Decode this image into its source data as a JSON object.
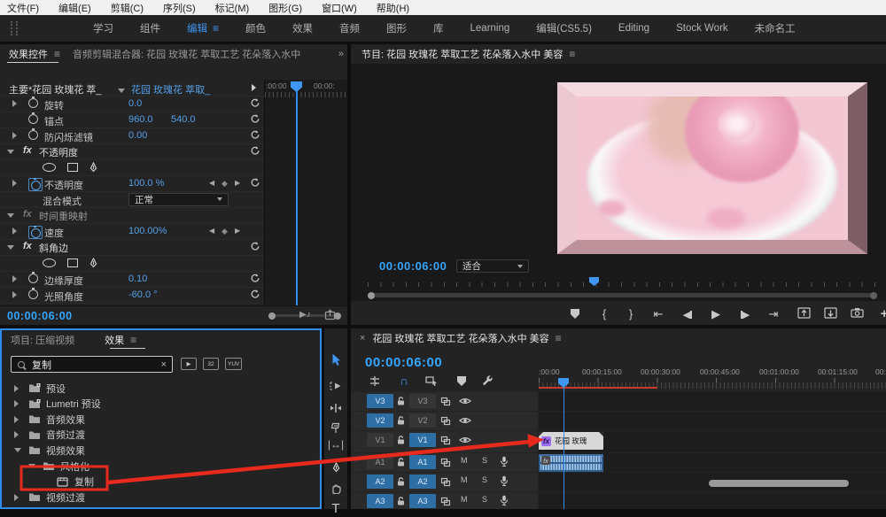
{
  "app": {
    "menu": [
      "文件(F)",
      "编辑(E)",
      "剪辑(C)",
      "序列(S)",
      "标记(M)",
      "图形(G)",
      "窗口(W)",
      "帮助(H)"
    ],
    "workspaces": [
      "学习",
      "组件",
      "编辑",
      "颜色",
      "效果",
      "音频",
      "图形",
      "库",
      "Learning",
      "编辑(CS5.5)",
      "Editing",
      "Stock Work",
      "未命名工"
    ],
    "active_workspace": "编辑"
  },
  "effect_controls": {
    "tab": "效果控件",
    "neighbor_tab": "音频剪辑混合器: 花园 玫瑰花 萃取工艺 花朵落入水中",
    "overflow_chevron": "»",
    "master_clip": "主要*花园 玫瑰花 萃_",
    "selected_clip": "花园 玫瑰花 萃取_",
    "ruler_labels": [
      ":00:00",
      "00:00:"
    ],
    "rows": [
      {
        "kind": "prop",
        "twirl": "right",
        "label": "旋转",
        "values": [
          "0.0"
        ],
        "reset": true
      },
      {
        "kind": "prop",
        "twirl": "none",
        "label": "锚点",
        "values": [
          "960.0",
          "540.0"
        ],
        "reset": true
      },
      {
        "kind": "prop",
        "twirl": "right",
        "label": "防闪烁滤镜",
        "values": [
          "0.00"
        ],
        "reset": true
      },
      {
        "kind": "fx",
        "label": "不透明度",
        "reset": true,
        "dim": false
      },
      {
        "kind": "shapes"
      },
      {
        "kind": "prop",
        "twirl": "right",
        "label": "不透明度",
        "values": [
          "100.0 %"
        ],
        "keyframe_nav": true,
        "reset": true,
        "stopwatch_on": true
      },
      {
        "kind": "select",
        "label": "混合模式",
        "value": "正常",
        "reset": true
      },
      {
        "kind": "fx",
        "label": "时间重映射",
        "reset": false,
        "dim": true
      },
      {
        "kind": "prop",
        "twirl": "right",
        "label": "速度",
        "values": [
          "100.00%"
        ],
        "keyframe_nav": true,
        "reset": false,
        "stopwatch_on": true
      },
      {
        "kind": "fx",
        "label": "斜角边",
        "reset": true,
        "dim": false
      },
      {
        "kind": "shapes"
      },
      {
        "kind": "prop",
        "twirl": "right",
        "label": "边缘厚度",
        "values": [
          "0.10"
        ],
        "reset": true
      },
      {
        "kind": "prop",
        "twirl": "right",
        "label": "光照角度",
        "values": [
          "-60.0 °"
        ],
        "reset": true
      }
    ],
    "timecode": "00:00:06:00"
  },
  "program_monitor": {
    "tab": "节目: 花园 玫瑰花 萃取工艺 花朵落入水中 美容",
    "timecode": "00:00:06:00",
    "zoom_level": "适合",
    "transport": [
      "add-marker",
      "mark-in",
      "mark-out",
      "go-to-in",
      "step-back",
      "play",
      "step-forward",
      "go-to-out",
      "lift",
      "extract",
      "export-frame",
      "button-editor"
    ]
  },
  "project_panel": {
    "tab_project": "项目: 压缩视频",
    "tab_effects": "效果",
    "search_value": "复制",
    "filter_badges": [
      "▶",
      "32",
      "YUV"
    ],
    "tree": [
      {
        "twirl": "right",
        "icon": "preset-folder",
        "label": "预设",
        "indent": 0
      },
      {
        "twirl": "right",
        "icon": "preset-folder",
        "label": "Lumetri 预设",
        "indent": 0
      },
      {
        "twirl": "right",
        "icon": "folder",
        "label": "音频效果",
        "indent": 0
      },
      {
        "twirl": "right",
        "icon": "folder",
        "label": "音频过渡",
        "indent": 0
      },
      {
        "twirl": "down",
        "icon": "folder",
        "label": "视频效果",
        "indent": 0
      },
      {
        "twirl": "down",
        "icon": "folder",
        "label": "风格化",
        "indent": 1
      },
      {
        "twirl": "none",
        "icon": "effect",
        "label": "复制",
        "indent": 2,
        "annotated": true
      },
      {
        "twirl": "right",
        "icon": "folder",
        "label": "视频过渡",
        "indent": 0
      }
    ]
  },
  "tools": [
    "selection",
    "track-select-forward",
    "ripple-edit",
    "razor",
    "slip",
    "pen",
    "hand",
    "type"
  ],
  "timeline": {
    "tab": "花园 玫瑰花 萃取工艺 花朵落入水中 美容",
    "close_glyph": "×",
    "timecode": "00:00:06:00",
    "toolbar": [
      "nest",
      "snap",
      "linked-selection",
      "add-marker",
      "settings"
    ],
    "ruler_labels": [
      ":00:00",
      "00:00:15:00",
      "00:00:30:00",
      "00:00:45:00",
      "00:01:00:00",
      "00:01:15:00",
      "00:"
    ],
    "tracks": [
      {
        "patch": "V3",
        "name": "V3",
        "patch_on": true,
        "target_on": false,
        "type": "video"
      },
      {
        "patch": "V2",
        "name": "V2",
        "patch_on": true,
        "target_on": false,
        "type": "video"
      },
      {
        "patch": "V1",
        "name": "V1",
        "patch_on": false,
        "target_on": true,
        "type": "video"
      },
      {
        "patch": "A1",
        "name": "A1",
        "patch_on": false,
        "target_on": true,
        "type": "audio"
      },
      {
        "patch": "A2",
        "name": "A2",
        "patch_on": true,
        "target_on": true,
        "type": "audio"
      },
      {
        "patch": "A3",
        "name": "A3",
        "patch_on": true,
        "target_on": true,
        "type": "audio"
      }
    ],
    "mute_label": "M",
    "solo_label": "S",
    "video_clip_label": "花园 玫瑰",
    "fx_badge": "fx"
  },
  "colors": {
    "accent_blue": "#3f96f5",
    "value_blue": "#55a0e8",
    "timecode_blue": "#35a6ff",
    "track_blue": "#2d6ea5",
    "annotation_red": "#e8291d",
    "render_red": "#c9392f"
  }
}
